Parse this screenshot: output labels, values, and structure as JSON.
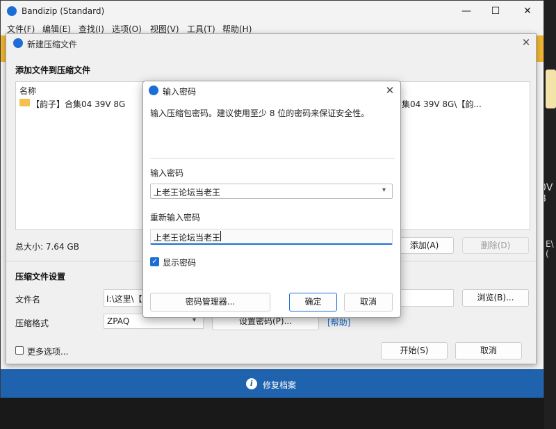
{
  "main_window": {
    "title": "Bandizip (Standard)",
    "minimize_glyph": "—",
    "maximize_glyph": "☐",
    "close_glyph": "✕",
    "menu": [
      "文件(F)",
      "编辑(E)",
      "查找(I)",
      "选项(O)",
      "视图(V)",
      "工具(T)",
      "帮助(H)"
    ],
    "footer_text": "修复档案",
    "footer_icon": "i"
  },
  "background": {
    "right_text_1": "0V 8",
    "right_text_2": "E\\ ("
  },
  "new_archive_dialog": {
    "title": "新建压缩文件",
    "heading": "添加文件到压缩文件",
    "list": {
      "column_header": "名称",
      "items": [
        "【韵子】合集04 39V 8G"
      ],
      "right_text": "集04 39V 8G\\【韵..."
    },
    "total_size": "总大小: 7.64 GB",
    "add_button": "添加(A)",
    "delete_button": "删除(D)",
    "settings_heading": "压缩文件设置",
    "filename_label": "文件名",
    "filename_value": "I:\\这里\\【",
    "browse_button": "浏览(B)...",
    "format_label": "压缩格式",
    "format_value": "ZPAQ",
    "set_password_button": "设置密码(P)...",
    "help_link": "[帮助]",
    "more_options_label": "更多选项...",
    "start_button": "开始(S)",
    "cancel_button": "取消"
  },
  "password_dialog": {
    "title": "输入密码",
    "description": "输入压缩包密码。建议使用至少 8 位的密码来保证安全性。",
    "password_label": "输入密码",
    "password_value": "上老王论坛当老王",
    "confirm_label": "重新输入密码",
    "confirm_value": "上老王论坛当老王",
    "show_password_label": "显示密码",
    "show_password_checked": true,
    "manager_button": "密码管理器...",
    "ok_button": "确定",
    "cancel_button": "取消"
  },
  "colors": {
    "accent": "#1c6ed6",
    "banner": "#f2b631",
    "footer": "#1f62ad"
  }
}
